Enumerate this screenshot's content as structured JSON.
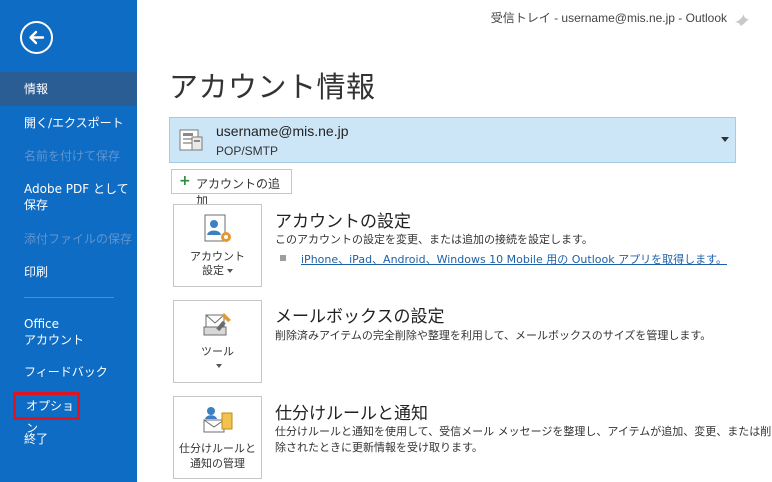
{
  "window": {
    "title": "受信トレイ - username@mis.ne.jp  -  Outlook"
  },
  "sidebar": {
    "items": [
      {
        "label": "情報",
        "state": "active"
      },
      {
        "label": "開く/エクスポート",
        "state": "normal"
      },
      {
        "label": "名前を付けて保存",
        "state": "disabled"
      },
      {
        "label": "Adobe PDF として\n保存",
        "state": "normal"
      },
      {
        "label": "添付ファイルの保存",
        "state": "disabled"
      },
      {
        "label": "印刷",
        "state": "normal"
      },
      {
        "label": "Office\nアカウント",
        "state": "normal"
      },
      {
        "label": "フィードバック",
        "state": "normal"
      },
      {
        "label": "オプション",
        "state": "highlighted"
      },
      {
        "label": "終了",
        "state": "normal"
      }
    ]
  },
  "main": {
    "title": "アカウント情報",
    "account": {
      "email": "username@mis.ne.jp",
      "type": "POP/SMTP"
    },
    "add_account_label": "アカウントの追加",
    "sections": [
      {
        "tile_label_1": "アカウント",
        "tile_label_2": "設定",
        "title": "アカウントの設定",
        "desc": "このアカウントの設定を変更、または追加の接続を設定します。",
        "link": "iPhone、iPad、Android、Windows 10 Mobile 用の Outlook アプリを取得します。"
      },
      {
        "tile_label_1": "ツール",
        "title": "メールボックスの設定",
        "desc": "削除済みアイテムの完全削除や整理を利用して、メールボックスのサイズを管理します。"
      },
      {
        "tile_label_1": "仕分けルールと",
        "tile_label_2": "通知の管理",
        "title": "仕分けルールと通知",
        "desc_1": "仕分けルールと通知を使用して、受信メール メッセージを整理し、アイテムが追加、変更、または削",
        "desc_2": "除されたときに更新情報を受け取ります。"
      }
    ]
  },
  "colors": {
    "sidebar_bg": "#0f6cc4",
    "sidebar_active": "#2a5d94",
    "account_bg": "#cde6f7",
    "highlight_outline": "#e0141e",
    "link": "#1e60a8"
  },
  "icons": {
    "back": "back-arrow-icon",
    "account": "account-card-icon",
    "account_settings": "account-settings-icon",
    "tools": "tools-icon",
    "rules": "rules-alerts-icon",
    "app": "outlook-bird-icon"
  }
}
